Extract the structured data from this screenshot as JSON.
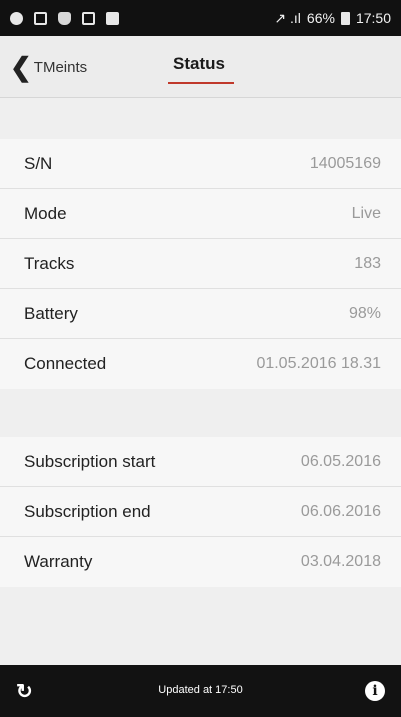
{
  "status_bar": {
    "icons": [
      "messenger-icon",
      "gallery-icon",
      "bug-icon",
      "mail-icon",
      "bag-icon"
    ],
    "signal_text": "↗ .ıl",
    "battery_percent": "66%",
    "time": "17:50"
  },
  "nav": {
    "back_label": "TMeints",
    "title": "Status"
  },
  "section1": [
    {
      "label": "S/N",
      "value": "14005169"
    },
    {
      "label": "Mode",
      "value": "Live"
    },
    {
      "label": "Tracks",
      "value": "183"
    },
    {
      "label": "Battery",
      "value": "98%"
    },
    {
      "label": "Connected",
      "value": "01.05.2016 18.31"
    }
  ],
  "section2": [
    {
      "label": "Subscription start",
      "value": "06.05.2016"
    },
    {
      "label": "Subscription end",
      "value": "06.06.2016"
    },
    {
      "label": "Warranty",
      "value": "03.04.2018"
    }
  ],
  "bottom_bar": {
    "updated_text": "Updated at 17:50"
  },
  "colors": {
    "accent_underline": "#c0392b",
    "bar_dark": "#121212"
  }
}
